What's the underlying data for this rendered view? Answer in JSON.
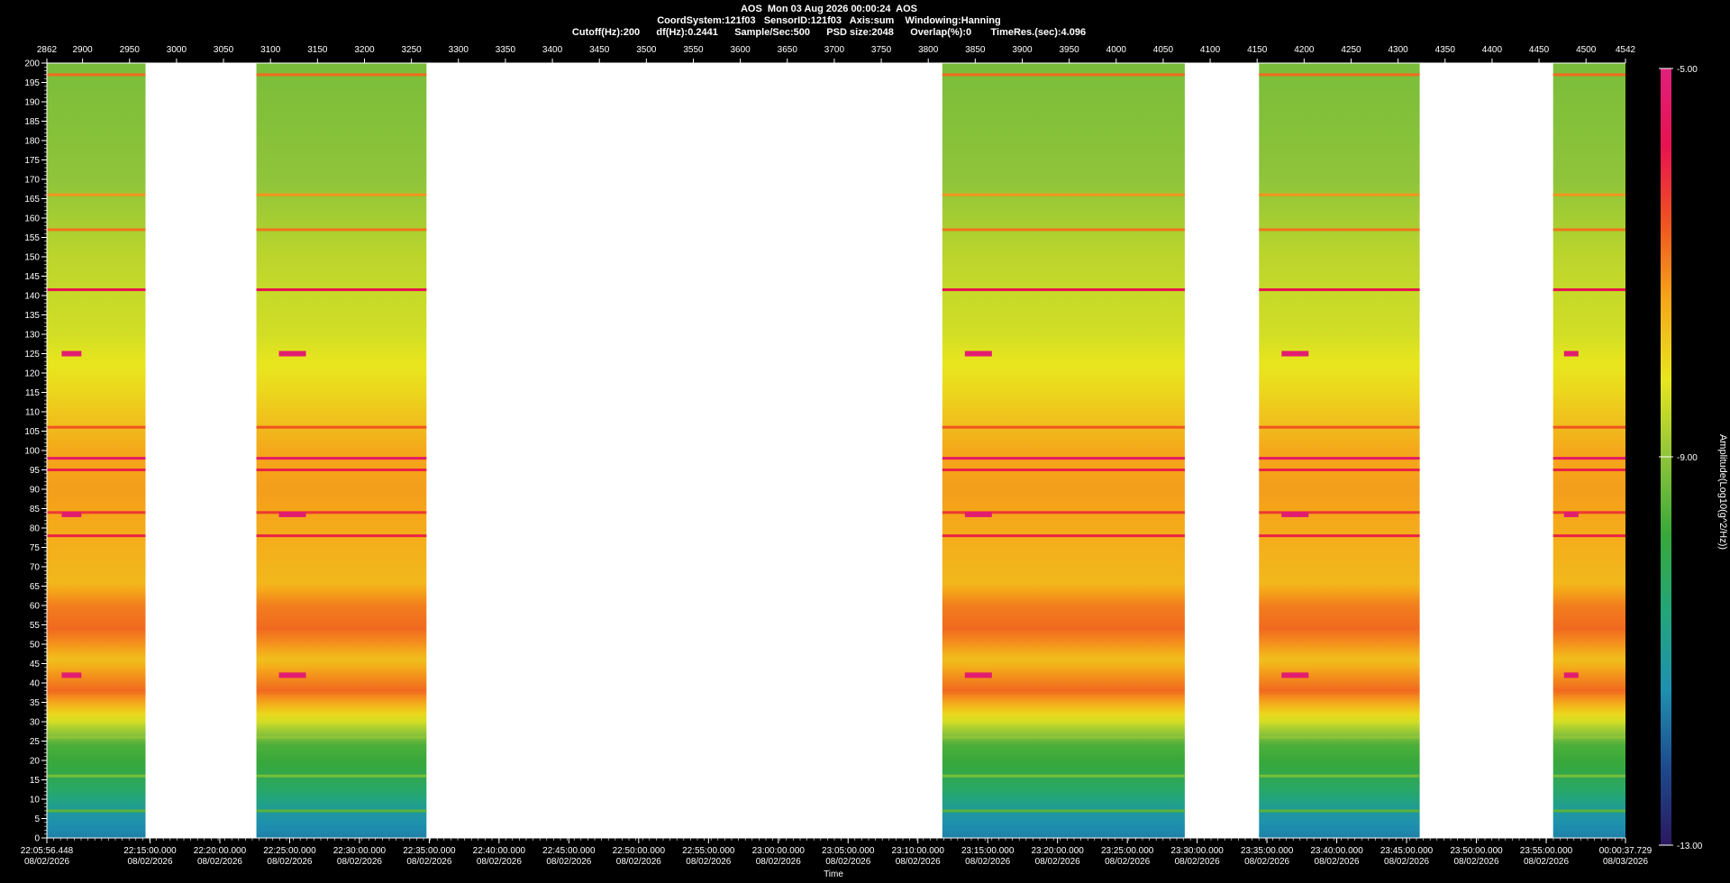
{
  "header": {
    "line1": "AOS  Mon 03 Aug 2026 00:00:24  AOS",
    "line2": "CoordSystem:121f03   SensorID:121f03   Axis:sum    Windowing:Hanning",
    "line3": "Cutoff(Hz):200      df(Hz):0.2441      Sample/Sec:500      PSD size:2048      Overlap(%):0       TimeRes.(sec):4.096"
  },
  "chart_data": {
    "type": "heatmap",
    "title": "AOS  Mon 03 Aug 2026 00:00:24  AOS",
    "xlabel": "Time",
    "ylabel": "",
    "y_frequency_hz_range": [
      0,
      200
    ],
    "y_ticks": [
      0,
      5,
      10,
      15,
      20,
      25,
      30,
      35,
      40,
      45,
      50,
      55,
      60,
      65,
      70,
      75,
      80,
      85,
      90,
      95,
      100,
      105,
      110,
      115,
      120,
      125,
      130,
      135,
      140,
      145,
      150,
      155,
      160,
      165,
      170,
      175,
      180,
      185,
      190,
      195,
      200
    ],
    "top_axis_range": [
      2862,
      4542
    ],
    "top_ticks": [
      "2862",
      "2900",
      "2950",
      "3000",
      "3050",
      "3100",
      "3150",
      "3200",
      "3250",
      "3300",
      "3350",
      "3400",
      "3450",
      "3500",
      "3550",
      "3600",
      "3650",
      "3700",
      "3750",
      "3800",
      "3850",
      "3900",
      "3950",
      "4000",
      "4050",
      "4100",
      "4150",
      "4200",
      "4250",
      "4300",
      "4350",
      "4400",
      "4450",
      "4500",
      "4542"
    ],
    "bottom_ticks": [
      {
        "time": "22:05:56.448",
        "date": "08/02/2026"
      },
      {
        "time": "22:15:00.000",
        "date": "08/02/2026"
      },
      {
        "time": "22:20:00.000",
        "date": "08/02/2026"
      },
      {
        "time": "22:25:00.000",
        "date": "08/02/2026"
      },
      {
        "time": "22:30:00.000",
        "date": "08/02/2026"
      },
      {
        "time": "22:35:00.000",
        "date": "08/02/2026"
      },
      {
        "time": "22:40:00.000",
        "date": "08/02/2026"
      },
      {
        "time": "22:45:00.000",
        "date": "08/02/2026"
      },
      {
        "time": "22:50:00.000",
        "date": "08/02/2026"
      },
      {
        "time": "22:55:00.000",
        "date": "08/02/2026"
      },
      {
        "time": "23:00:00.000",
        "date": "08/02/2026"
      },
      {
        "time": "23:05:00.000",
        "date": "08/02/2026"
      },
      {
        "time": "23:10:00.000",
        "date": "08/02/2026"
      },
      {
        "time": "23:15:00.000",
        "date": "08/02/2026"
      },
      {
        "time": "23:20:00.000",
        "date": "08/02/2026"
      },
      {
        "time": "23:25:00.000",
        "date": "08/02/2026"
      },
      {
        "time": "23:30:00.000",
        "date": "08/02/2026"
      },
      {
        "time": "23:35:00.000",
        "date": "08/02/2026"
      },
      {
        "time": "23:40:00.000",
        "date": "08/02/2026"
      },
      {
        "time": "23:45:00.000",
        "date": "08/02/2026"
      },
      {
        "time": "23:50:00.000",
        "date": "08/02/2026"
      },
      {
        "time": "23:55:00.000",
        "date": "08/02/2026"
      },
      {
        "time": "00:00:37.729",
        "date": "08/03/2026"
      }
    ],
    "data_segments_top_axis": [
      [
        2862,
        2967
      ],
      [
        3085,
        3266
      ],
      [
        3815,
        4073
      ],
      [
        4152,
        4323
      ],
      [
        4465,
        4542
      ]
    ],
    "gap_segments_top_axis": [
      [
        2967,
        3085
      ],
      [
        3266,
        3815
      ],
      [
        4073,
        4152
      ],
      [
        4323,
        4465
      ]
    ],
    "tonal_lines_hz": [
      {
        "hz": 197,
        "level": -6.8
      },
      {
        "hz": 166,
        "level": -7.2
      },
      {
        "hz": 157,
        "level": -6.9
      },
      {
        "hz": 141.5,
        "level": -5.8
      },
      {
        "hz": 106,
        "level": -6.6
      },
      {
        "hz": 98,
        "level": -5.4
      },
      {
        "hz": 95,
        "level": -6.0
      },
      {
        "hz": 84,
        "level": -6.3
      },
      {
        "hz": 78,
        "level": -6.0
      },
      {
        "hz": 26,
        "level": -9.0
      },
      {
        "hz": 16,
        "level": -9.2
      },
      {
        "hz": 7,
        "level": -9.5
      }
    ],
    "intermittent_tones_hz": [
      125,
      83.5,
      42
    ],
    "colorbar": {
      "label": "Amplitude(Log10(g^2/Hz))",
      "min": -13.0,
      "max": -5.0,
      "ticks": [
        "-5.00",
        "-9.00",
        "-13.00"
      ],
      "colors": [
        "#2b1860",
        "#1d4a8c",
        "#1e90b0",
        "#22a67a",
        "#38a83a",
        "#8fc43a",
        "#e8e61e",
        "#f5a81a",
        "#ef5420",
        "#e81250",
        "#e0207a"
      ]
    }
  }
}
